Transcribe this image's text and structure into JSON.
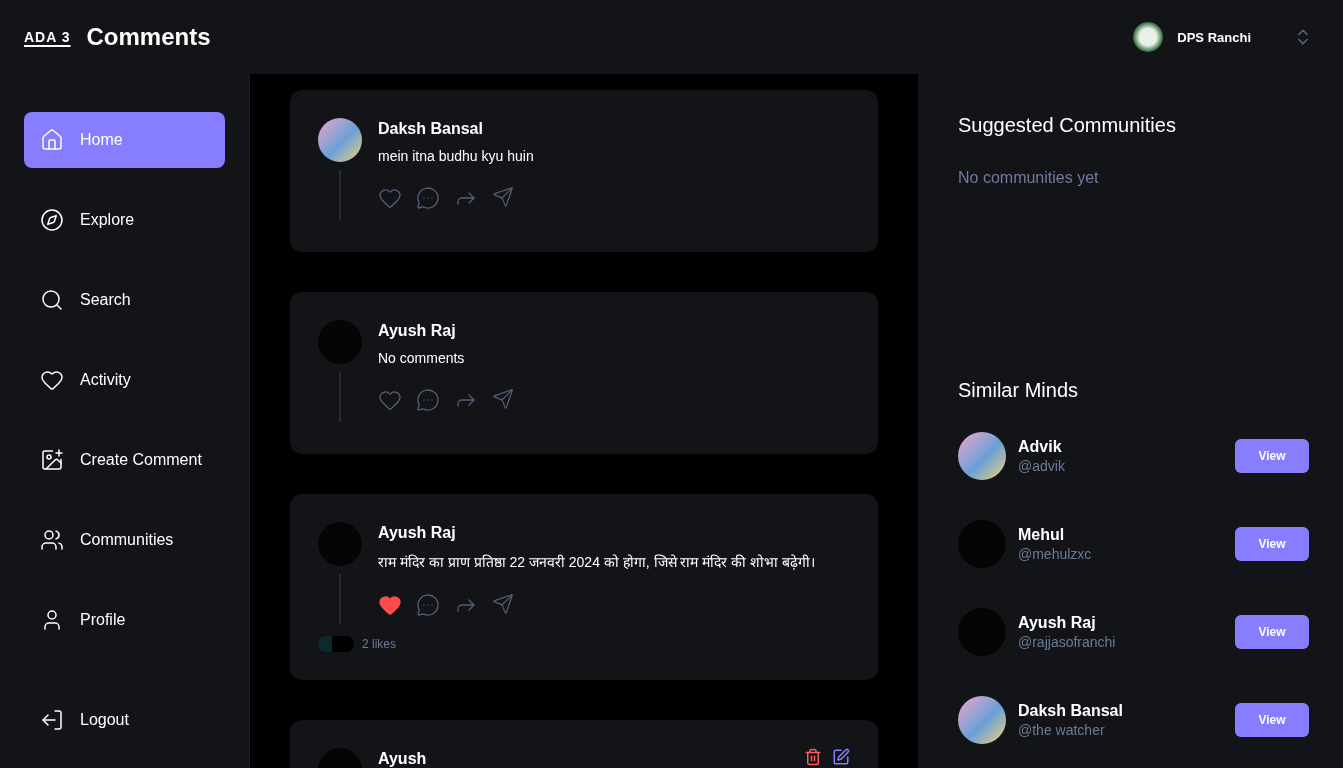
{
  "topbar": {
    "logo": "ADA 3",
    "title": "Comments",
    "organization": {
      "name": "DPS Ranchi"
    }
  },
  "sidebar": {
    "items": [
      {
        "label": "Home",
        "selected": true
      },
      {
        "label": "Explore",
        "selected": false
      },
      {
        "label": "Search",
        "selected": false
      },
      {
        "label": "Activity",
        "selected": false
      },
      {
        "label": "Create Comment",
        "selected": false
      },
      {
        "label": "Communities",
        "selected": false
      },
      {
        "label": "Profile",
        "selected": false
      }
    ],
    "logout": {
      "label": "Logout"
    }
  },
  "feed": [
    {
      "author": "Daksh Bansal",
      "kind": "photo",
      "text": "mein itna budhu kyu huin",
      "liked": false,
      "own": false
    },
    {
      "author": "Ayush Raj",
      "kind": "dark",
      "text": "No comments",
      "liked": false,
      "own": false
    },
    {
      "author": "Ayush Raj",
      "kind": "dark",
      "text": "राम मंदिर का प्राण प्रतिष्ठा 22 जनवरी 2024 को होगा, जिसे राम मंदिर की शोभा बढ़ेगी।",
      "liked": true,
      "own": false,
      "likes": "2 likes"
    },
    {
      "author": "Ayush",
      "kind": "dark",
      "own": true
    }
  ],
  "suggested_communities": {
    "title": "Suggested Communities",
    "empty": "No communities yet"
  },
  "similar_minds": {
    "title": "Similar Minds",
    "users": [
      {
        "name": "Advik",
        "handle": "@advik",
        "kind": "photo",
        "button": "View"
      },
      {
        "name": "Mehul",
        "handle": "@mehulzxc",
        "kind": "dark",
        "button": "View"
      },
      {
        "name": "Ayush Raj",
        "handle": "@rajjasofranchi",
        "kind": "dark",
        "button": "View"
      },
      {
        "name": "Daksh Bansal",
        "handle": "@the watcher",
        "kind": "photo",
        "button": "View"
      }
    ]
  }
}
